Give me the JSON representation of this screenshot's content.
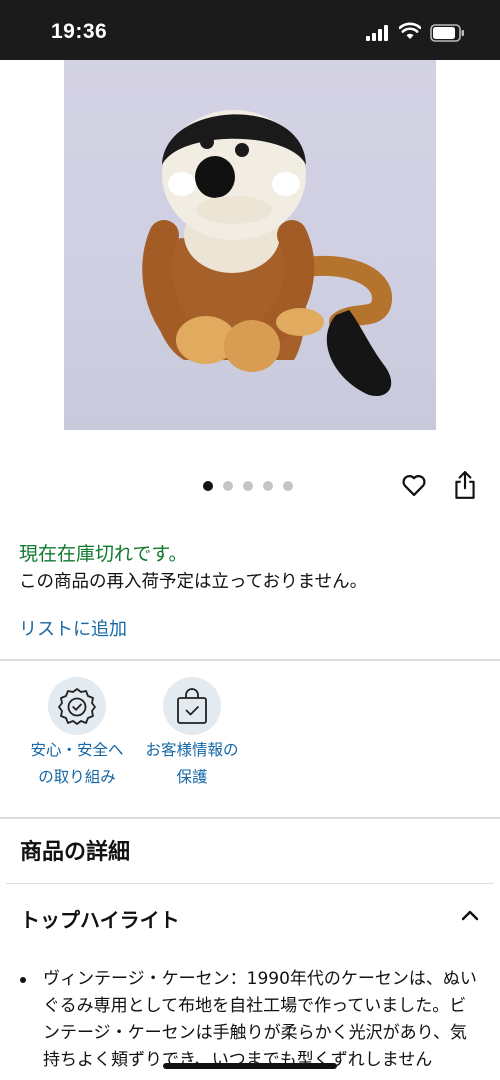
{
  "status_bar": {
    "time": "19:36"
  },
  "product": {
    "image_alt": "",
    "carousel": {
      "total": 5,
      "active_index": 0
    }
  },
  "availability": {
    "status": "現在在庫切れです。",
    "restock_note": "この商品の再入荷予定は立っておりません。",
    "add_to_list": "リストに追加"
  },
  "badges": [
    {
      "icon": "safety-badge-icon",
      "line1": "安心・安全へ",
      "line2": "の取り組み"
    },
    {
      "icon": "shopping-bag-check-icon",
      "line1": "お客様情報の",
      "line2": "保護"
    }
  ],
  "details": {
    "title": "商品の詳細",
    "highlights_title": "トップハイライト",
    "highlights": [
      "ヴィンテージ・ケーセン：1990年代のケーセンは、ぬいぐるみ専用として布地を自社工場で作っていました。ビンテージ・ケーセンは手触りが柔らかく光沢があり、気持ちよく頬ずりでき、いつまでも型くずれしません"
    ]
  },
  "colors": {
    "status_bar": "#1b1b1b",
    "in_stock_green": "#107a2e",
    "link_blue": "#1667a6",
    "badge_bg": "#e3eaf0"
  }
}
